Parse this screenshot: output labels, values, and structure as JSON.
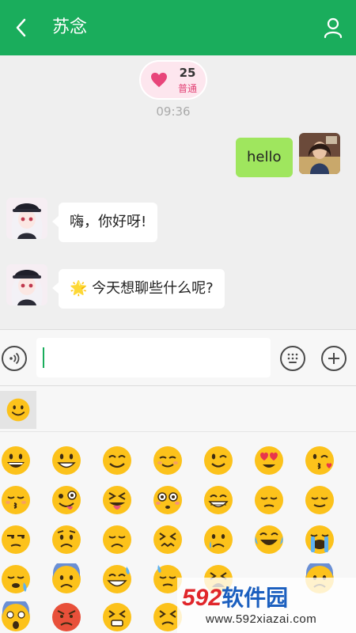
{
  "header": {
    "title": "苏念"
  },
  "intimacy": {
    "value": "25",
    "level": "普通"
  },
  "chat": {
    "timestamp": "09:36",
    "messages": [
      {
        "from": "me",
        "text": "hello"
      },
      {
        "from": "other",
        "text": "嗨，你好呀!"
      },
      {
        "from": "other",
        "emoji": "🌟",
        "text": "今天想聊些什么呢?"
      }
    ]
  },
  "input": {
    "value": ""
  },
  "emoji_panel": {
    "active_tab": "smiley"
  },
  "watermark": {
    "brand_number": "592",
    "brand_text": "软件园",
    "url": "www.592xiazai.com"
  },
  "colors": {
    "header_bg": "#1aad5c",
    "my_bubble": "#9fe65e",
    "other_bubble": "#ffffff",
    "badge_bg": "#fde6ee",
    "heart": "#e8457a",
    "emoji_face": "#fcc21b"
  }
}
